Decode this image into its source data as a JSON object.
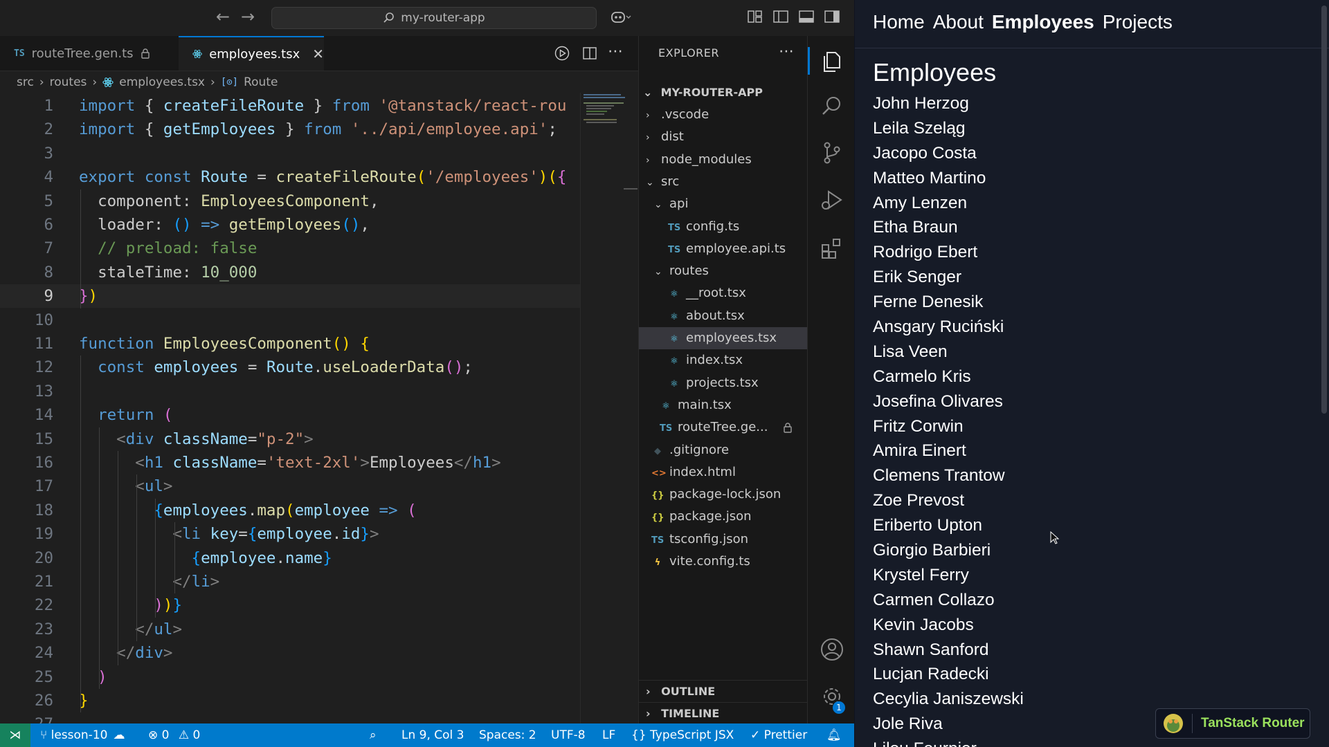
{
  "titlebar": {
    "search_text": "my-router-app"
  },
  "tabs": [
    {
      "badge": "TS",
      "label": "routeTree.gen.ts"
    },
    {
      "label": "employees.tsx"
    }
  ],
  "breadcrumb": [
    "src",
    "routes",
    "employees.tsx",
    "Route"
  ],
  "editor": {
    "current_line": 9,
    "lines": [
      [
        [
          "import ",
          "#569cd6"
        ],
        [
          "{ ",
          "#cccccc"
        ],
        [
          "createFileRoute",
          "#9cdcfe"
        ],
        [
          " } ",
          "#cccccc"
        ],
        [
          "from ",
          "#569cd6"
        ],
        [
          "'@tanstack/react-rou",
          "#ce9178"
        ]
      ],
      [
        [
          "import ",
          "#569cd6"
        ],
        [
          "{ ",
          "#cccccc"
        ],
        [
          "getEmployees",
          "#9cdcfe"
        ],
        [
          " } ",
          "#cccccc"
        ],
        [
          "from ",
          "#569cd6"
        ],
        [
          "'../api/employee.api'",
          "#ce9178"
        ],
        [
          ";",
          "#cccccc"
        ]
      ],
      [],
      [
        [
          "export ",
          "#569cd6"
        ],
        [
          "const ",
          "#569cd6"
        ],
        [
          "Route",
          "#9cdcfe"
        ],
        [
          " = ",
          "#cccccc"
        ],
        [
          "createFileRoute",
          "#dcdcaa"
        ],
        [
          "(",
          "#ffd700"
        ],
        [
          "'/employees'",
          "#ce9178"
        ],
        [
          ")",
          "#ffd700"
        ],
        [
          "(",
          "#ffd700"
        ],
        [
          "{",
          "#da70d6"
        ]
      ],
      [
        [
          "  component",
          "#cccccc"
        ],
        [
          ": ",
          "#cccccc"
        ],
        [
          "EmployeesComponent",
          "#dcdcaa"
        ],
        [
          ",",
          "#cccccc"
        ]
      ],
      [
        [
          "  loader",
          "#cccccc"
        ],
        [
          ": ",
          "#cccccc"
        ],
        [
          "() ",
          "#179fff"
        ],
        [
          "=> ",
          "#569cd6"
        ],
        [
          "getEmployees",
          "#dcdcaa"
        ],
        [
          "()",
          "#179fff"
        ],
        [
          ",",
          "#cccccc"
        ]
      ],
      [
        [
          "  // preload: false",
          "#6a9955"
        ]
      ],
      [
        [
          "  staleTime",
          "#cccccc"
        ],
        [
          ": ",
          "#cccccc"
        ],
        [
          "10_000",
          "#b5cea8"
        ]
      ],
      [
        [
          "}",
          "#da70d6"
        ],
        [
          ")",
          "#ffd700"
        ]
      ],
      [],
      [
        [
          "function ",
          "#569cd6"
        ],
        [
          "EmployeesComponent",
          "#dcdcaa"
        ],
        [
          "() ",
          "#ffd700"
        ],
        [
          "{",
          "#ffd700"
        ]
      ],
      [
        [
          "  const ",
          "#569cd6"
        ],
        [
          "employees",
          "#9cdcfe"
        ],
        [
          " = ",
          "#cccccc"
        ],
        [
          "Route",
          "#9cdcfe"
        ],
        [
          ".",
          "#cccccc"
        ],
        [
          "useLoaderData",
          "#dcdcaa"
        ],
        [
          "()",
          "#da70d6"
        ],
        [
          ";",
          "#cccccc"
        ]
      ],
      [],
      [
        [
          "  return ",
          "#569cd6"
        ],
        [
          "(",
          "#da70d6"
        ]
      ],
      [
        [
          "    <",
          "#808080"
        ],
        [
          "div ",
          "#569cd6"
        ],
        [
          "className",
          "#9cdcfe"
        ],
        [
          "=",
          "#cccccc"
        ],
        [
          "\"p-2\"",
          "#ce9178"
        ],
        [
          ">",
          "#808080"
        ]
      ],
      [
        [
          "      <",
          "#808080"
        ],
        [
          "h1 ",
          "#569cd6"
        ],
        [
          "className",
          "#9cdcfe"
        ],
        [
          "=",
          "#cccccc"
        ],
        [
          "'text-2xl'",
          "#ce9178"
        ],
        [
          ">",
          "#808080"
        ],
        [
          "Employees",
          "#cccccc"
        ],
        [
          "</",
          "#808080"
        ],
        [
          "h1",
          "#569cd6"
        ],
        [
          ">",
          "#808080"
        ]
      ],
      [
        [
          "      <",
          "#808080"
        ],
        [
          "ul",
          "#569cd6"
        ],
        [
          ">",
          "#808080"
        ]
      ],
      [
        [
          "        {",
          "#179fff"
        ],
        [
          "employees",
          "#9cdcfe"
        ],
        [
          ".",
          "#cccccc"
        ],
        [
          "map",
          "#dcdcaa"
        ],
        [
          "(",
          "#ffd700"
        ],
        [
          "employee",
          "#9cdcfe"
        ],
        [
          " => ",
          "#569cd6"
        ],
        [
          "(",
          "#da70d6"
        ]
      ],
      [
        [
          "          <",
          "#808080"
        ],
        [
          "li ",
          "#569cd6"
        ],
        [
          "key",
          "#9cdcfe"
        ],
        [
          "=",
          "#cccccc"
        ],
        [
          "{",
          "#179fff"
        ],
        [
          "employee",
          "#9cdcfe"
        ],
        [
          ".",
          "#cccccc"
        ],
        [
          "id",
          "#9cdcfe"
        ],
        [
          "}",
          "#179fff"
        ],
        [
          ">",
          "#808080"
        ]
      ],
      [
        [
          "            {",
          "#179fff"
        ],
        [
          "employee",
          "#9cdcfe"
        ],
        [
          ".",
          "#cccccc"
        ],
        [
          "name",
          "#9cdcfe"
        ],
        [
          "}",
          "#179fff"
        ]
      ],
      [
        [
          "          </",
          "#808080"
        ],
        [
          "li",
          "#569cd6"
        ],
        [
          ">",
          "#808080"
        ]
      ],
      [
        [
          "        )",
          "#da70d6"
        ],
        [
          ")",
          "#ffd700"
        ],
        [
          "}",
          "#179fff"
        ]
      ],
      [
        [
          "      </",
          "#808080"
        ],
        [
          "ul",
          "#569cd6"
        ],
        [
          ">",
          "#808080"
        ]
      ],
      [
        [
          "    </",
          "#808080"
        ],
        [
          "div",
          "#569cd6"
        ],
        [
          ">",
          "#808080"
        ]
      ],
      [
        [
          "  )",
          "#da70d6"
        ]
      ],
      [
        [
          "}",
          "#ffd700"
        ]
      ],
      []
    ]
  },
  "explorer": {
    "title": "EXPLORER",
    "project": "MY-ROUTER-APP",
    "items": [
      {
        "name": ".vscode",
        "type": "folder",
        "open": false,
        "indent": 1
      },
      {
        "name": "dist",
        "type": "folder",
        "open": false,
        "indent": 1
      },
      {
        "name": "node_modules",
        "type": "folder",
        "open": false,
        "indent": 1
      },
      {
        "name": "src",
        "type": "folder",
        "open": true,
        "indent": 1
      },
      {
        "name": "api",
        "type": "folder",
        "open": true,
        "indent": 2
      },
      {
        "name": "config.ts",
        "type": "ts",
        "indent": 3
      },
      {
        "name": "employee.api.ts",
        "type": "ts",
        "indent": 3
      },
      {
        "name": "routes",
        "type": "folder",
        "open": true,
        "indent": 2
      },
      {
        "name": "__root.tsx",
        "type": "react",
        "indent": 3
      },
      {
        "name": "about.tsx",
        "type": "react",
        "indent": 3
      },
      {
        "name": "employees.tsx",
        "type": "react",
        "indent": 3,
        "selected": true
      },
      {
        "name": "index.tsx",
        "type": "react",
        "indent": 3
      },
      {
        "name": "projects.tsx",
        "type": "react",
        "indent": 3
      },
      {
        "name": "main.tsx",
        "type": "react",
        "indent": 2
      },
      {
        "name": "routeTree.ge...",
        "type": "ts",
        "indent": 2,
        "locked": true
      },
      {
        "name": ".gitignore",
        "type": "git",
        "indent": 1
      },
      {
        "name": "index.html",
        "type": "html",
        "indent": 1
      },
      {
        "name": "package-lock.json",
        "type": "json",
        "indent": 1
      },
      {
        "name": "package.json",
        "type": "json",
        "indent": 1
      },
      {
        "name": "tsconfig.json",
        "type": "tsconfig",
        "indent": 1
      },
      {
        "name": "vite.config.ts",
        "type": "vite",
        "indent": 1
      }
    ],
    "outline": "OUTLINE",
    "timeline": "TIMELINE"
  },
  "activity": {
    "settings_badge": "1"
  },
  "statusbar": {
    "branch": "lesson-10",
    "errors": "0",
    "warnings": "0",
    "position": "Ln 9, Col 3",
    "spaces": "Spaces: 2",
    "encoding": "UTF-8",
    "eol": "LF",
    "language": "TypeScript JSX",
    "formatter": "Prettier"
  },
  "browser": {
    "nav": [
      "Home",
      "About",
      "Employees",
      "Projects"
    ],
    "nav_active": 2,
    "heading": "Employees",
    "employees": [
      "John Herzog",
      "Leila Szeląg",
      "Jacopo Costa",
      "Matteo Martino",
      "Amy Lenzen",
      "Etha Braun",
      "Rodrigo Ebert",
      "Erik Senger",
      "Ferne Denesik",
      "Ansgary Ruciński",
      "Lisa Veen",
      "Carmelo Kris",
      "Josefina Olivares",
      "Fritz Corwin",
      "Amira Einert",
      "Clemens Trantow",
      "Zoe Prevost",
      "Eriberto Upton",
      "Giorgio Barbieri",
      "Krystel Ferry",
      "Carmen Collazo",
      "Kevin Jacobs",
      "Shawn Sanford",
      "Lucjan Radecki",
      "Cecylia Janiszewski",
      "Jole Riva",
      "Lilou Fournier"
    ],
    "devtools_label": "TanStack Router"
  }
}
